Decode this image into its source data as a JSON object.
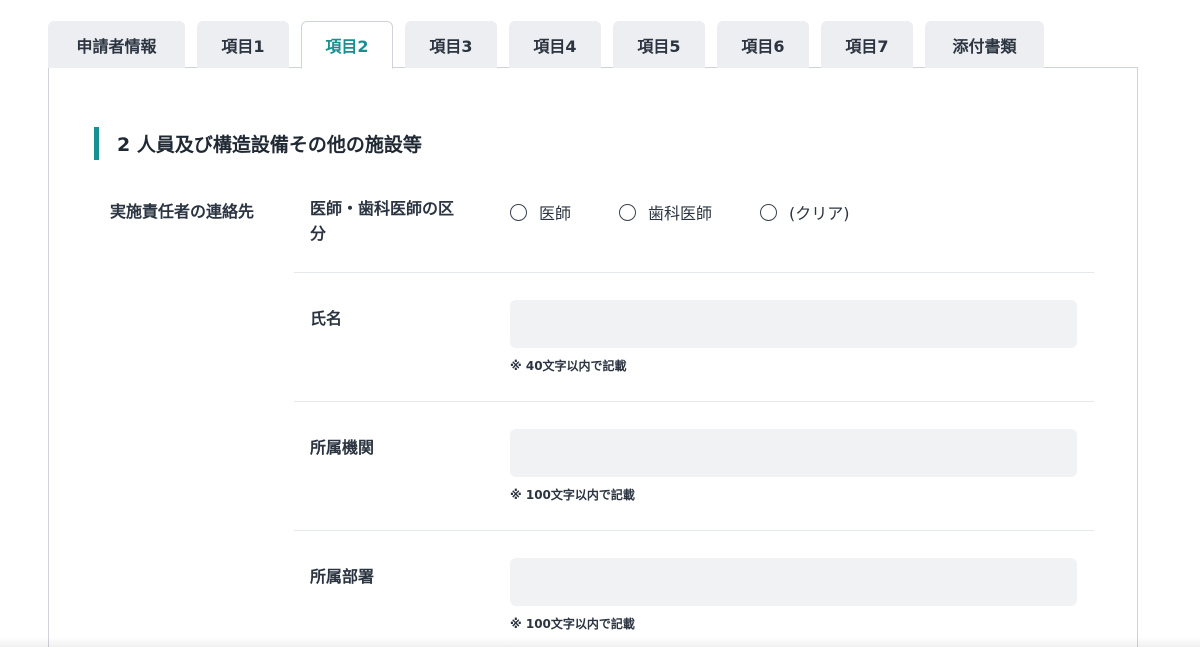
{
  "tabs": [
    {
      "label": "申請者情報"
    },
    {
      "label": "項目1"
    },
    {
      "label": "項目2"
    },
    {
      "label": "項目3"
    },
    {
      "label": "項目4"
    },
    {
      "label": "項目5"
    },
    {
      "label": "項目6"
    },
    {
      "label": "項目7"
    },
    {
      "label": "添付書類"
    }
  ],
  "active_tab": "項目2",
  "accent_color": "#1a8f8f",
  "section": {
    "title": "2 人員及び構造設備その他の施設等",
    "group_label": "実施責任者の連絡先",
    "doctor_type": {
      "label_line1": "医師・歯科医師の区",
      "label_line2": "分",
      "options": [
        "医師",
        "歯科医師",
        "(クリア)"
      ]
    },
    "name": {
      "label": "氏名",
      "value": "",
      "hint": "※ 40文字以内で記載"
    },
    "institution": {
      "label": "所属機関",
      "value": "",
      "hint": "※ 100文字以内で記載"
    },
    "department": {
      "label": "所属部署",
      "value": "",
      "hint": "※ 100文字以内で記載"
    }
  }
}
